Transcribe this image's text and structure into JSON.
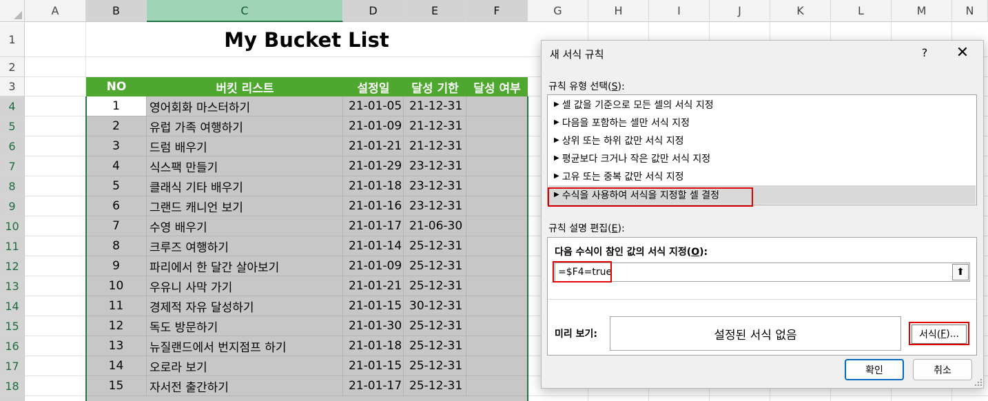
{
  "columns": [
    "A",
    "B",
    "C",
    "D",
    "E",
    "F",
    "G",
    "H",
    "I",
    "J",
    "K",
    "L",
    "M",
    "N"
  ],
  "rows": [
    "1",
    "2",
    "3",
    "4",
    "5",
    "6",
    "7",
    "8",
    "9",
    "10",
    "11",
    "12",
    "13",
    "14",
    "15",
    "16",
    "17",
    "18"
  ],
  "sheet": {
    "title": "My Bucket List",
    "headers": {
      "no": "NO",
      "item": "버킷 리스트",
      "set_date": "설정일",
      "deadline": "달성 기한",
      "achieved": "달성 여부"
    },
    "data": [
      {
        "no": "1",
        "item": "영어회화 마스터하기",
        "set_date": "21-01-05",
        "deadline": "21-12-31",
        "achieved": ""
      },
      {
        "no": "2",
        "item": "유럽 가족 여행하기",
        "set_date": "21-01-09",
        "deadline": "21-12-31",
        "achieved": ""
      },
      {
        "no": "3",
        "item": "드럼 배우기",
        "set_date": "21-01-21",
        "deadline": "21-12-31",
        "achieved": ""
      },
      {
        "no": "4",
        "item": "식스팩 만들기",
        "set_date": "21-01-29",
        "deadline": "23-12-31",
        "achieved": ""
      },
      {
        "no": "5",
        "item": "클래식 기타 배우기",
        "set_date": "21-01-18",
        "deadline": "23-12-31",
        "achieved": ""
      },
      {
        "no": "6",
        "item": "그랜드 캐니언 보기",
        "set_date": "21-01-16",
        "deadline": "23-12-31",
        "achieved": ""
      },
      {
        "no": "7",
        "item": "수영 배우기",
        "set_date": "21-01-17",
        "deadline": "21-06-30",
        "achieved": ""
      },
      {
        "no": "8",
        "item": "크루즈 여행하기",
        "set_date": "21-01-14",
        "deadline": "25-12-31",
        "achieved": ""
      },
      {
        "no": "9",
        "item": "파리에서 한 달간 살아보기",
        "set_date": "21-01-09",
        "deadline": "25-12-31",
        "achieved": ""
      },
      {
        "no": "10",
        "item": "우유니 사막 가기",
        "set_date": "21-01-21",
        "deadline": "25-12-31",
        "achieved": ""
      },
      {
        "no": "11",
        "item": "경제적 자유 달성하기",
        "set_date": "21-01-15",
        "deadline": "30-12-31",
        "achieved": ""
      },
      {
        "no": "12",
        "item": "독도 방문하기",
        "set_date": "21-01-30",
        "deadline": "25-12-31",
        "achieved": ""
      },
      {
        "no": "13",
        "item": "뉴질랜드에서 번지점프 하기",
        "set_date": "21-01-18",
        "deadline": "25-12-31",
        "achieved": ""
      },
      {
        "no": "14",
        "item": "오로라 보기",
        "set_date": "21-01-15",
        "deadline": "25-12-31",
        "achieved": ""
      },
      {
        "no": "15",
        "item": "자서전 출간하기",
        "set_date": "21-01-17",
        "deadline": "25-12-31",
        "achieved": ""
      }
    ]
  },
  "dialog": {
    "title": "새 서식 규칙",
    "help": "?",
    "close": "✕",
    "rule_type_label": "규칙 유형 선택(",
    "rule_type_key": "S",
    "rule_type_suffix": "):",
    "rule_types": [
      "셀 값을 기준으로 모든 셀의 서식 지정",
      "다음을 포함하는 셀만 서식 지정",
      "상위 또는 하위 값만 서식 지정",
      "평균보다 크거나 작은 값만 서식 지정",
      "고유 또는 중복 값만 서식 지정",
      "수식을 사용하여 서식을 지정할 셀 결정"
    ],
    "selected_rule_index": 5,
    "edit_label": "규칙 설명 편집(",
    "edit_key": "E",
    "edit_suffix": "):",
    "formula_label": "다음 수식이 참인 값의 서식 지정(",
    "formula_key": "O",
    "formula_suffix": "):",
    "formula_value": "=$F4=true",
    "preview_label": "미리 보기:",
    "preview_text": "설정된 서식 없음",
    "format_button": "서식(",
    "format_key": "F",
    "format_suffix": ")...",
    "ok_button": "확인",
    "cancel_button": "취소"
  },
  "colors": {
    "header_green": "#4ea72e",
    "selection_green": "#217346",
    "highlight_red": "#e00000",
    "data_fill": "#c7c7c7"
  }
}
